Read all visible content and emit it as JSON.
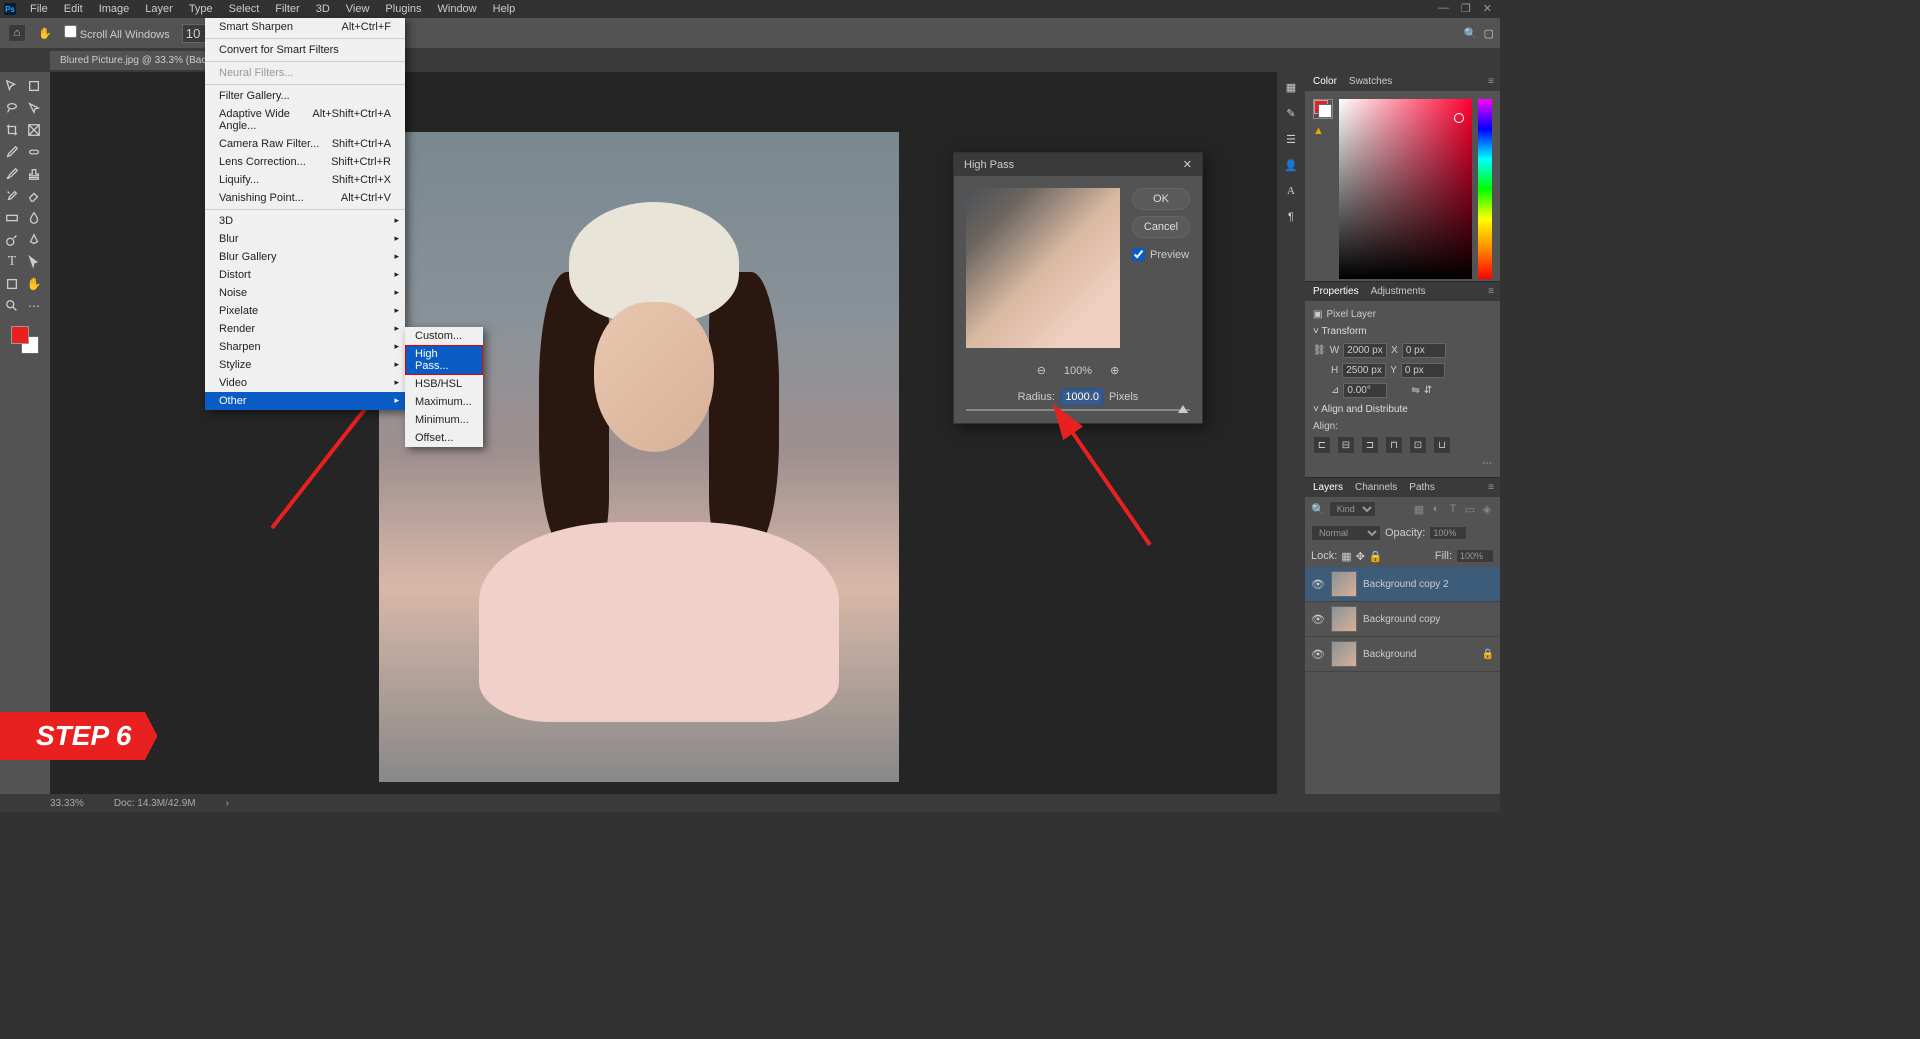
{
  "app": {
    "icon": "Ps"
  },
  "menu": {
    "file": "File",
    "edit": "Edit",
    "image": "Image",
    "layer": "Layer",
    "type": "Type",
    "select": "Select",
    "filter": "Filter",
    "threeD": "3D",
    "view": "View",
    "plugins": "Plugins",
    "window": "Window",
    "help": "Help"
  },
  "options": {
    "scroll_all": "Scroll All Windows",
    "zoom_val": "10",
    "search": "🔍",
    "share": "▢"
  },
  "doc_tab": "Blured Picture.jpg @ 33.3% (Back...)",
  "filter_menu": {
    "smart_sharpen": {
      "label": "Smart Sharpen",
      "shortcut": "Alt+Ctrl+F"
    },
    "convert_smart": "Convert for Smart Filters",
    "neural": "Neural Filters...",
    "filter_gallery": "Filter Gallery...",
    "adaptive": {
      "label": "Adaptive Wide Angle...",
      "shortcut": "Alt+Shift+Ctrl+A"
    },
    "camera_raw": {
      "label": "Camera Raw Filter...",
      "shortcut": "Shift+Ctrl+A"
    },
    "lens": {
      "label": "Lens Correction...",
      "shortcut": "Shift+Ctrl+R"
    },
    "liquify": {
      "label": "Liquify...",
      "shortcut": "Shift+Ctrl+X"
    },
    "vanishing": {
      "label": "Vanishing Point...",
      "shortcut": "Alt+Ctrl+V"
    },
    "three_d": "3D",
    "blur": "Blur",
    "blur_gallery": "Blur Gallery",
    "distort": "Distort",
    "noise": "Noise",
    "pixelate": "Pixelate",
    "render": "Render",
    "sharpen": "Sharpen",
    "stylize": "Stylize",
    "video": "Video",
    "other": "Other"
  },
  "submenu": {
    "custom": "Custom...",
    "high_pass": "High Pass...",
    "hsb": "HSB/HSL",
    "maximum": "Maximum...",
    "minimum": "Minimum...",
    "offset": "Offset..."
  },
  "high_pass": {
    "title": "High Pass",
    "ok": "OK",
    "cancel": "Cancel",
    "preview": "Preview",
    "zoom": "100%",
    "radius_label": "Radius:",
    "radius_val": "1000.0",
    "pixels": "Pixels",
    "close": "✕"
  },
  "panels": {
    "color": {
      "tab1": "Color",
      "tab2": "Swatches"
    },
    "properties": {
      "tab1": "Properties",
      "tab2": "Adjustments",
      "type": "Pixel Layer",
      "transform": "Transform",
      "w": "W",
      "w_val": "2000 px",
      "h": "H",
      "h_val": "2500 px",
      "x": "X",
      "x_val": "0 px",
      "y": "Y",
      "y_val": "0 px",
      "angle": "0.00°",
      "align_dist": "Align and Distribute",
      "align": "Align:"
    },
    "layers": {
      "tab1": "Layers",
      "tab2": "Channels",
      "tab3": "Paths",
      "kind": "Kind",
      "normal": "Normal",
      "opacity": "Opacity:",
      "opacity_val": "100%",
      "lock": "Lock:",
      "fill": "Fill:",
      "fill_val": "100%",
      "items": [
        {
          "name": "Background copy 2"
        },
        {
          "name": "Background copy"
        },
        {
          "name": "Background"
        }
      ]
    }
  },
  "step": "STEP 6",
  "status": {
    "zoom": "33.33%",
    "doc": "Doc: 14.3M/42.9M"
  }
}
